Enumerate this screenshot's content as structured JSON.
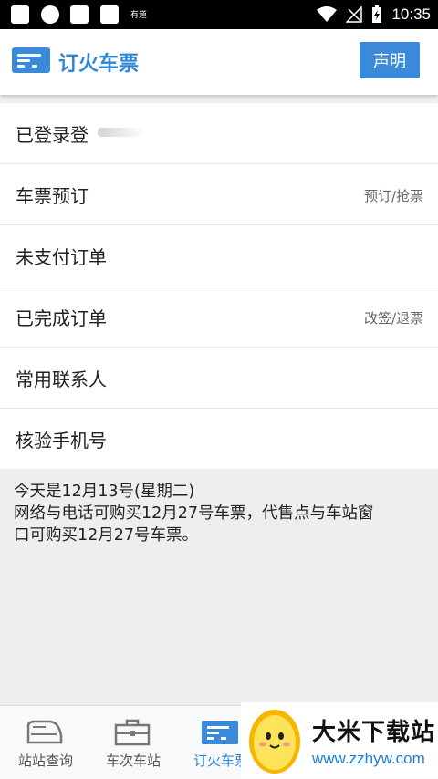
{
  "status_bar": {
    "app_name": "有道",
    "time": "10:35",
    "icons": [
      "notification-square-icon",
      "circle-icon",
      "notification-square-icon",
      "notification-square-icon",
      "wifi-icon",
      "no-signal-icon",
      "battery-charging-icon"
    ]
  },
  "header": {
    "title": "订火车票",
    "statement_button": "声明"
  },
  "menu": {
    "items": [
      {
        "label": "已登录登",
        "sub": ""
      },
      {
        "label": "车票预订",
        "sub": "预订/抢票"
      },
      {
        "label": "未支付订单",
        "sub": ""
      },
      {
        "label": "已完成订单",
        "sub": "改签/退票"
      },
      {
        "label": "常用联系人",
        "sub": ""
      },
      {
        "label": "核验手机号",
        "sub": ""
      }
    ]
  },
  "notice": {
    "line1": "今天是12月13号(星期二)",
    "line2": "网络与电话可购买12月27号车票，代售点与车站窗",
    "line3": "口可购买12月27号车票。"
  },
  "tabs": [
    {
      "label": "站站查询",
      "icon": "train-icon"
    },
    {
      "label": "车次车站",
      "icon": "briefcase-icon"
    },
    {
      "label": "订火车票",
      "icon": "ticket-icon"
    }
  ],
  "watermark": {
    "name": "大米下载站",
    "url": "www.zzhyw.com"
  },
  "colors": {
    "accent": "#3b8ad9",
    "title_blue": "#2f86d6",
    "background": "#eeeeee"
  }
}
